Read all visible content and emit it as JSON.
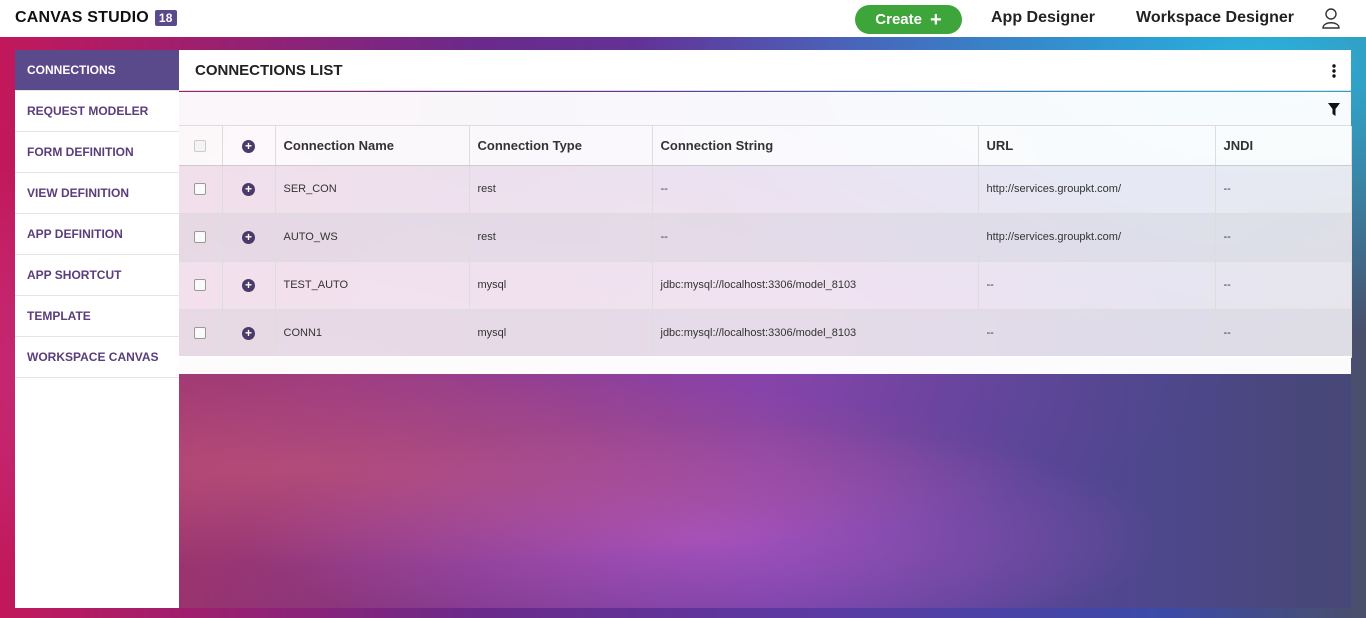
{
  "header": {
    "brand": "CANVAS STUDIO",
    "version": "18",
    "create_label": "Create",
    "create_icon": "plus-icon",
    "nav": [
      "App Designer",
      "Workspace Designer"
    ],
    "user_icon": "user-icon"
  },
  "colors": {
    "accent": "#5a4a8c",
    "create_green": "#3ea53a"
  },
  "sidebar": {
    "items": [
      {
        "label": "CONNECTIONS",
        "active": true
      },
      {
        "label": "REQUEST MODELER"
      },
      {
        "label": "FORM DEFINITION"
      },
      {
        "label": "VIEW DEFINITION"
      },
      {
        "label": "APP DEFINITION"
      },
      {
        "label": "APP SHORTCUT"
      },
      {
        "label": "TEMPLATE"
      },
      {
        "label": "WORKSPACE CANVAS"
      }
    ]
  },
  "main": {
    "title": "CONNECTIONS LIST",
    "menu_icon": "kebab-menu-icon",
    "filter_icon": "filter-icon",
    "columns": [
      "Connection Name",
      "Connection Type",
      "Connection String",
      "URL",
      "JNDI"
    ],
    "rows": [
      {
        "name": "SER_CON",
        "type": "rest",
        "conn_string": "--",
        "url": "http://services.groupkt.com/",
        "jndi": "--"
      },
      {
        "name": "AUTO_WS",
        "type": "rest",
        "conn_string": "--",
        "url": "http://services.groupkt.com/",
        "jndi": "--"
      },
      {
        "name": "TEST_AUTO",
        "type": "mysql",
        "conn_string": "jdbc:mysql://localhost:3306/model_8103",
        "url": "--",
        "jndi": "--"
      },
      {
        "name": "CONN1",
        "type": "mysql",
        "conn_string": "jdbc:mysql://localhost:3306/model_8103",
        "url": "--",
        "jndi": "--"
      }
    ]
  }
}
